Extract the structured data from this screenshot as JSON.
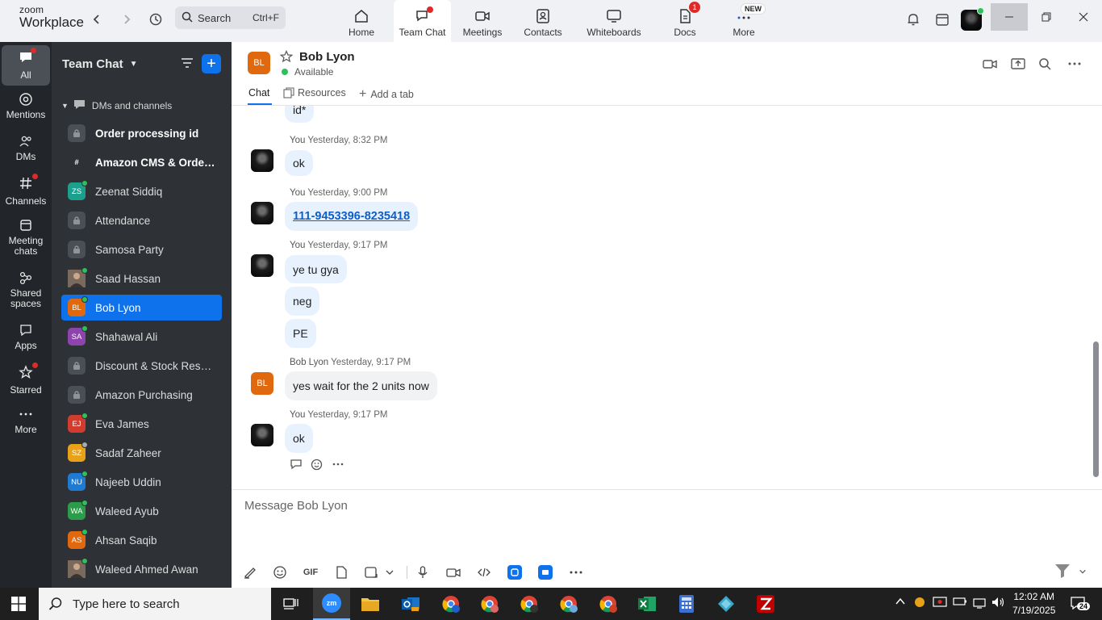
{
  "app": {
    "logo_line1": "zoom",
    "logo_line2": "Workplace",
    "search_label": "Search",
    "search_shortcut": "Ctrl+F"
  },
  "nav_tabs": [
    {
      "label": "Home",
      "icon": "home-icon"
    },
    {
      "label": "Team Chat",
      "icon": "team-chat-icon",
      "active": true
    },
    {
      "label": "Meetings",
      "icon": "video-camera-icon"
    },
    {
      "label": "Contacts",
      "icon": "contacts-icon"
    },
    {
      "label": "Whiteboards",
      "icon": "whiteboard-icon"
    },
    {
      "label": "Docs",
      "icon": "docs-icon",
      "badge": "1"
    },
    {
      "label": "More",
      "icon": "more-dots-icon",
      "badge": "NEW"
    }
  ],
  "rail": [
    {
      "label": "All",
      "icon": "chat-bubble-icon",
      "active": true
    },
    {
      "label": "Mentions",
      "icon": "at-icon"
    },
    {
      "label": "DMs",
      "icon": "people-icon"
    },
    {
      "label": "Channels",
      "icon": "hash-icon"
    },
    {
      "label": "Meeting chats",
      "icon": "calendar-chat-icon"
    },
    {
      "label": "Shared spaces",
      "icon": "shared-spaces-icon"
    },
    {
      "label": "Apps",
      "icon": "apps-icon"
    },
    {
      "label": "Starred",
      "icon": "star-icon"
    },
    {
      "label": "More",
      "icon": "ellipsis-icon"
    }
  ],
  "chat_list": {
    "title": "Team Chat",
    "section": "DMs and channels",
    "items": [
      {
        "name": "Order processing id",
        "type": "lock",
        "bold": true
      },
      {
        "name": "Amazon CMS & Order...",
        "type": "hash",
        "bold": true
      },
      {
        "name": "Zeenat Siddiq",
        "initials": "ZS",
        "color": "#1aa08c",
        "status": "online"
      },
      {
        "name": "Attendance",
        "type": "lock"
      },
      {
        "name": "Samosa Party",
        "type": "lock"
      },
      {
        "name": "Saad Hassan",
        "type": "photo",
        "status": "online"
      },
      {
        "name": "Bob Lyon",
        "initials": "BL",
        "color": "#e0690f",
        "status": "online",
        "active": true
      },
      {
        "name": "Shahawal Ali",
        "initials": "SA",
        "color": "#8e44ad",
        "status": "online"
      },
      {
        "name": "Discount & Stock Reser...",
        "type": "lock"
      },
      {
        "name": "Amazon Purchasing",
        "type": "lock"
      },
      {
        "name": "Eva James",
        "initials": "EJ",
        "color": "#d23c2f",
        "status": "online"
      },
      {
        "name": "Sadaf Zaheer",
        "initials": "SZ",
        "color": "#e8a21a",
        "status": "away"
      },
      {
        "name": "Najeeb Uddin",
        "initials": "NU",
        "color": "#1f7bd1",
        "status": "online"
      },
      {
        "name": "Waleed Ayub",
        "initials": "WA",
        "color": "#2b9d4a",
        "status": "online"
      },
      {
        "name": "Ahsan Saqib",
        "initials": "AS",
        "color": "#e0690f",
        "status": "online"
      },
      {
        "name": "Waleed Ahmed Awan",
        "type": "photo",
        "status": "online"
      }
    ]
  },
  "chat": {
    "contact_initials": "BL",
    "contact_name": "Bob Lyon",
    "status": "Available",
    "tabs": [
      "Chat",
      "Resources",
      "Add a tab"
    ]
  },
  "messages": {
    "m0_text": "id*",
    "m1_sender": "You",
    "m1_time": "Yesterday, 8:32 PM",
    "m1_text": "ok",
    "m2_sender": "You",
    "m2_time": "Yesterday, 9:00 PM",
    "m2_text": "111-9453396-8235418",
    "m3_sender": "You",
    "m3_time": "Yesterday, 9:17 PM",
    "m3_text": "ye tu gya",
    "m3b_text": "neg",
    "m3c_text": "PE",
    "m4_sender": "Bob Lyon",
    "m4_time": "Yesterday, 9:17 PM",
    "m4_text": "yes wait for the 2 units now",
    "m4_initials": "BL",
    "m5_sender": "You",
    "m5_time": "Yesterday, 9:17 PM",
    "m5_text": "ok"
  },
  "composer": {
    "placeholder": "Message Bob Lyon",
    "gif_label": "GIF"
  },
  "taskbar": {
    "search_placeholder": "Type here to search",
    "time": "12:02 AM",
    "date": "7/19/2025",
    "notifications": "24"
  },
  "colors": {
    "accent": "#0e72ed",
    "rail_bg": "#222529",
    "list_bg": "#2e3136",
    "bubble_bg": "#e8f2ff",
    "online": "#2cc15a"
  }
}
